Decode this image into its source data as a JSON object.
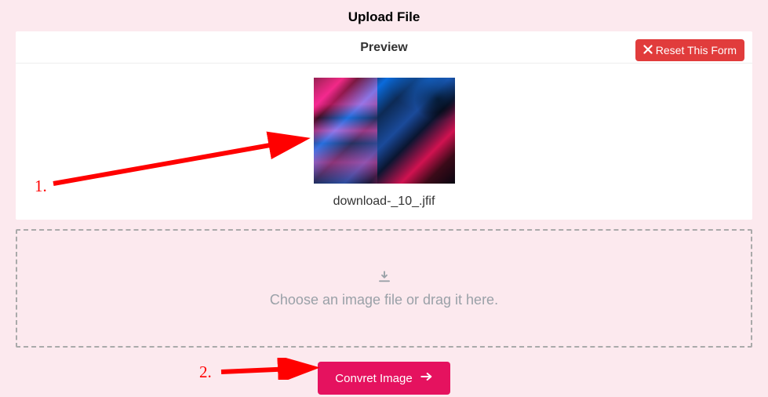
{
  "title": "Upload File",
  "preview": {
    "title": "Preview",
    "reset_label": "Reset This Form",
    "filename": "download-_10_.jfif"
  },
  "dropzone": {
    "text": "Choose an image file or drag it here."
  },
  "convert": {
    "label": "Convret Image"
  },
  "annotations": {
    "n1": "1.",
    "n2": "2."
  }
}
